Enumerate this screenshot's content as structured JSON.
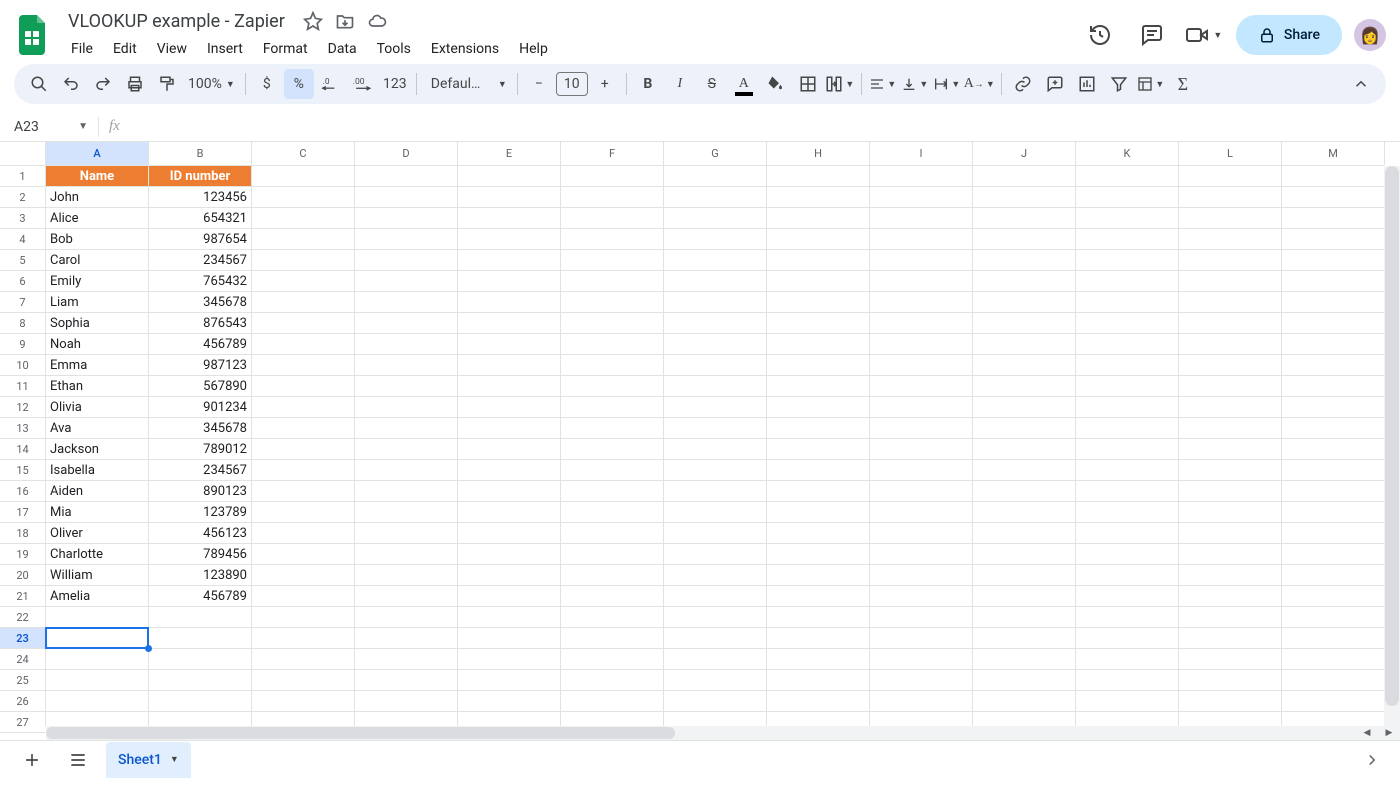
{
  "doc": {
    "title": "VLOOKUP example - Zapier"
  },
  "menu": [
    "File",
    "Edit",
    "View",
    "Insert",
    "Format",
    "Data",
    "Tools",
    "Extensions",
    "Help"
  ],
  "share": {
    "label": "Share"
  },
  "toolbar": {
    "zoom": "100%",
    "font": "Defaul…",
    "fontsize": "10",
    "fmt123": "123",
    "currency": "$",
    "percent": "%",
    "dec_down": ".0",
    "dec_up": ".00"
  },
  "namebox": "A23",
  "formula": "",
  "columns": [
    "A",
    "B",
    "C",
    "D",
    "E",
    "F",
    "G",
    "H",
    "I",
    "J",
    "K",
    "L",
    "M"
  ],
  "selected_col": "A",
  "row_count": 27,
  "selected_row": 23,
  "sheet": {
    "headers": [
      "Name",
      "ID number"
    ],
    "rows": [
      {
        "name": "John",
        "id": "123456"
      },
      {
        "name": "Alice",
        "id": "654321"
      },
      {
        "name": "Bob",
        "id": "987654"
      },
      {
        "name": "Carol",
        "id": "234567"
      },
      {
        "name": "Emily",
        "id": "765432"
      },
      {
        "name": "Liam",
        "id": "345678"
      },
      {
        "name": "Sophia",
        "id": "876543"
      },
      {
        "name": "Noah",
        "id": "456789"
      },
      {
        "name": "Emma",
        "id": "987123"
      },
      {
        "name": "Ethan",
        "id": "567890"
      },
      {
        "name": "Olivia",
        "id": "901234"
      },
      {
        "name": "Ava",
        "id": "345678"
      },
      {
        "name": "Jackson",
        "id": "789012"
      },
      {
        "name": "Isabella",
        "id": "234567"
      },
      {
        "name": "Aiden",
        "id": "890123"
      },
      {
        "name": "Mia",
        "id": "123789"
      },
      {
        "name": "Oliver",
        "id": "456123"
      },
      {
        "name": "Charlotte",
        "id": "789456"
      },
      {
        "name": "William",
        "id": "123890"
      },
      {
        "name": "Amelia",
        "id": "456789"
      }
    ]
  },
  "tabs": {
    "sheet1": "Sheet1"
  }
}
